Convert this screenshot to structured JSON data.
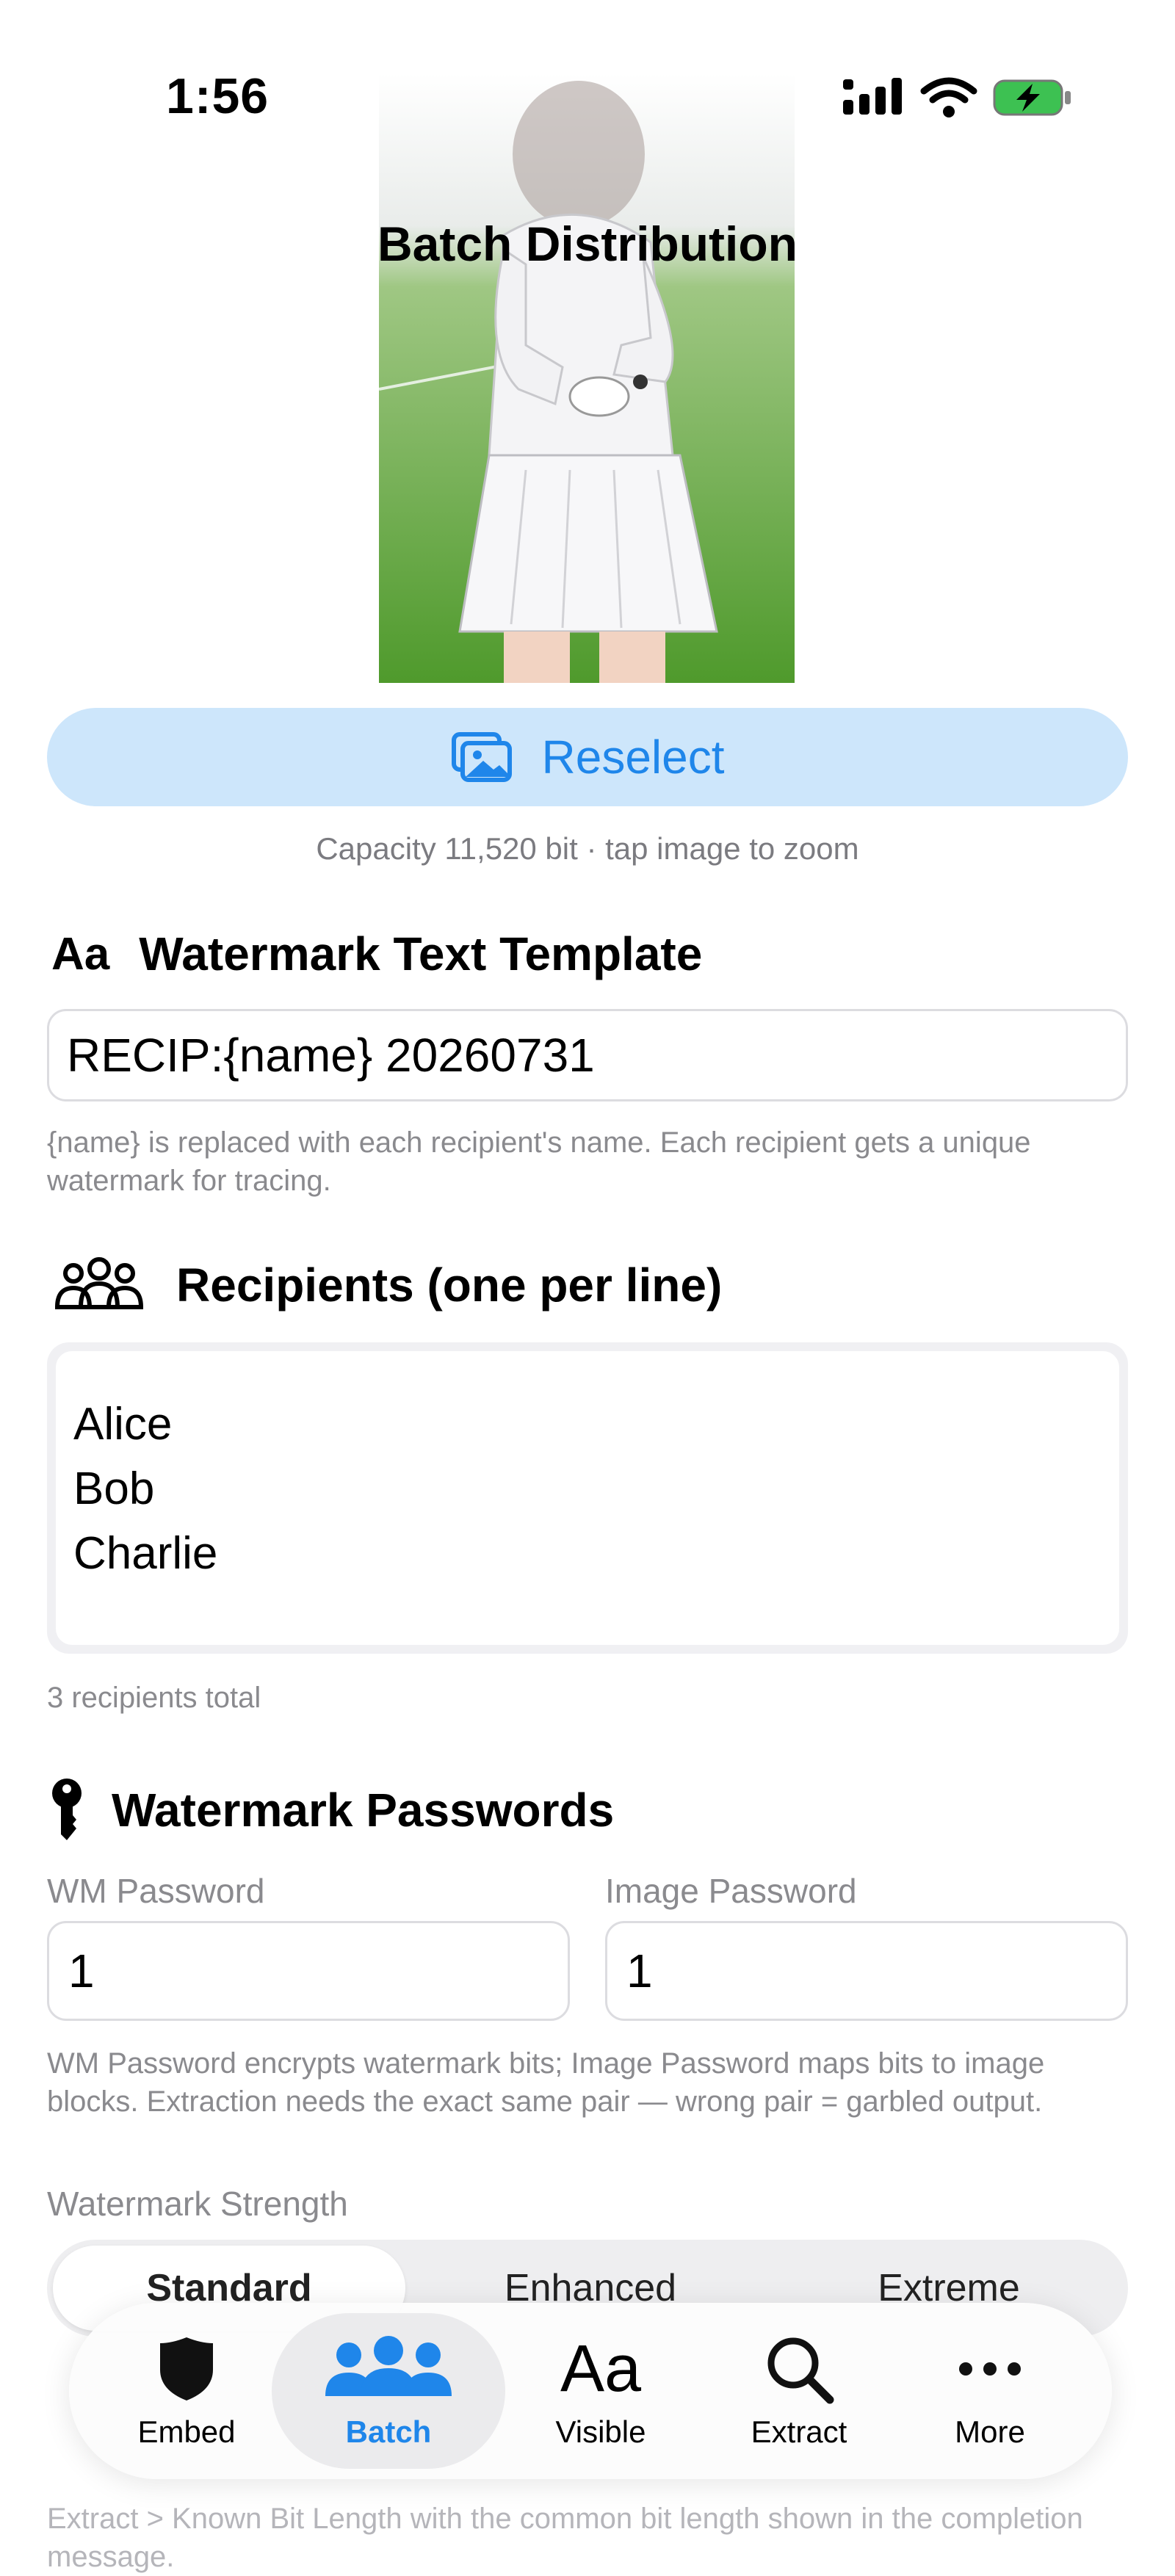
{
  "status": {
    "time": "1:56"
  },
  "header": {
    "title": "Batch Distribution"
  },
  "image": {
    "reselect_label": "Reselect",
    "capacity_text": "Capacity 11,520 bit · tap image to zoom"
  },
  "template": {
    "icon_text": "Aa",
    "title": "Watermark Text Template",
    "value": "RECIP:{name} 20260731",
    "help": "{name} is replaced with each recipient's name. Each recipient gets a unique watermark for tracing."
  },
  "recipients": {
    "title": "Recipients (one per line)",
    "lines": [
      "Alice",
      "Bob",
      "Charlie"
    ],
    "count_text": "3 recipients total"
  },
  "passwords": {
    "title": "Watermark Passwords",
    "wm_label": "WM Password",
    "wm_value": "1",
    "image_label": "Image Password",
    "image_value": "1",
    "help": "WM Password encrypts watermark bits; Image Password maps bits to image blocks. Extraction needs the exact same pair — wrong pair = garbled output."
  },
  "strength": {
    "label": "Watermark Strength",
    "options": [
      "Standard",
      "Enhanced",
      "Extreme"
    ],
    "selected": "Standard",
    "help_visible_tail": "Extract > Known Bit Length with the common bit length shown in the completion message."
  },
  "tabbar": {
    "active": "Batch",
    "accent_color": "#1f86ea",
    "items": [
      {
        "label": "Embed",
        "icon": "shield-icon"
      },
      {
        "label": "Batch",
        "icon": "people-icon"
      },
      {
        "label": "Visible",
        "icon": "aa-text-icon",
        "icon_text": "Aa"
      },
      {
        "label": "Extract",
        "icon": "magnifier-icon"
      },
      {
        "label": "More",
        "icon": "ellipsis-icon"
      }
    ]
  }
}
